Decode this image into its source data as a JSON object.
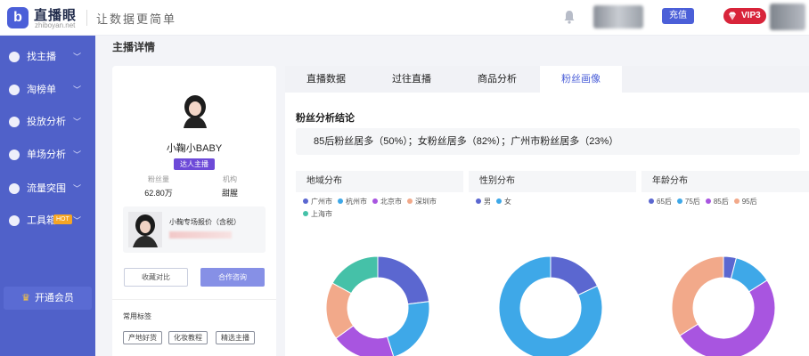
{
  "header": {
    "logo_letter": "b",
    "brand": "直播眼",
    "brand_sub": "zhiboyan.net",
    "slogan": "让数据更简单",
    "recharge_label": "充值",
    "vip_label": "VIP3"
  },
  "sidebar": {
    "items": [
      {
        "label": "找主播",
        "icon": "user-icon"
      },
      {
        "label": "淘榜单",
        "icon": "trophy-icon"
      },
      {
        "label": "投放分析",
        "icon": "chart-icon"
      },
      {
        "label": "单场分析",
        "icon": "plus-icon"
      },
      {
        "label": "流量突围",
        "icon": "flow-icon"
      },
      {
        "label": "工具箱",
        "icon": "tool-icon",
        "badge": "HOT"
      }
    ],
    "member_label": "开通会员"
  },
  "page_title": "主播详情",
  "profile": {
    "name": "小鞠小BABY",
    "tag": "达人主播",
    "fans_label": "粉丝量",
    "fans_value": "62.80万",
    "org_label": "机构",
    "org_value": "甜腥",
    "quote_title": "小鞠专场报价（含税）",
    "compare_label": "收藏对比",
    "consult_label": "合作咨询",
    "common_tags_label": "常用标签",
    "chips": [
      "产地好货",
      "化妆教程",
      "精选主播"
    ]
  },
  "tabs": [
    {
      "label": "直播数据",
      "active": false
    },
    {
      "label": "过往直播",
      "active": false
    },
    {
      "label": "商品分析",
      "active": false
    },
    {
      "label": "粉丝画像",
      "active": true
    }
  ],
  "analysis": {
    "title": "粉丝分析结论",
    "conclusion": "85后粉丝居多（50%）；女粉丝居多（82%）；广州市粉丝居多（23%）"
  },
  "colors": {
    "accent": "#4b5fd8",
    "sidebar": "#5061c9",
    "tag": "#6d4ad8"
  },
  "chart_data": [
    {
      "type": "pie",
      "title": "地域分布",
      "labels": [
        "广州市",
        "杭州市",
        "北京市",
        "深圳市",
        "上海市"
      ],
      "values": [
        23,
        22,
        20,
        18,
        17
      ],
      "colors": [
        "#5b67d0",
        "#3ea8e8",
        "#a855e0",
        "#f2a98a",
        "#45c1a8"
      ]
    },
    {
      "type": "pie",
      "title": "性别分布",
      "labels": [
        "男",
        "女"
      ],
      "values": [
        18,
        82
      ],
      "colors": [
        "#5b67d0",
        "#3ea8e8"
      ]
    },
    {
      "type": "pie",
      "title": "年龄分布",
      "labels": [
        "65后",
        "75后",
        "85后",
        "95后"
      ],
      "values": [
        4,
        12,
        50,
        34
      ],
      "colors": [
        "#5b67d0",
        "#3ea8e8",
        "#a855e0",
        "#f2a98a"
      ]
    }
  ]
}
